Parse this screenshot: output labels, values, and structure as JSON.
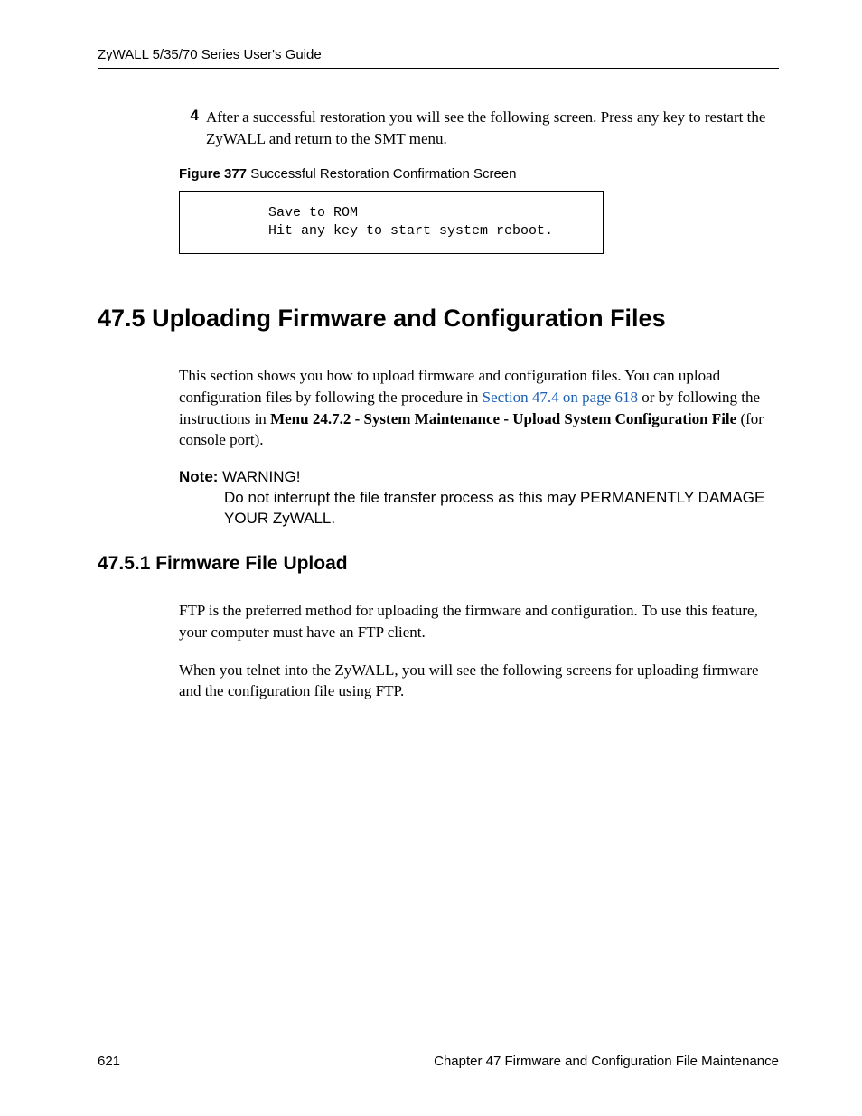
{
  "header": {
    "title": "ZyWALL 5/35/70 Series User's Guide"
  },
  "step4": {
    "num": "4",
    "text": "After a successful restoration you will see the following screen. Press any key to restart the ZyWALL and return to the SMT menu."
  },
  "figure": {
    "label": "Figure 377",
    "caption": "   Successful Restoration Confirmation Screen",
    "terminal_line1": "Save to ROM",
    "terminal_line2": "Hit any key to start system reboot."
  },
  "section": {
    "number": "47.5",
    "title": "  Uploading Firmware and Configuration Files",
    "para1_a": "This section shows you how to upload firmware and configuration files. You can upload configuration files by following the procedure in ",
    "para1_link": "Section 47.4 on page 618",
    "para1_b": " or by following the instructions in ",
    "para1_bold": "Menu 24.7.2 - System Maintenance - Upload System Configuration File",
    "para1_c": " (for console port).",
    "note_label": "Note: ",
    "note_first": "WARNING!",
    "note_rest": "Do not interrupt the file transfer process as this may PERMANENTLY DAMAGE YOUR ZyWALL."
  },
  "subsection": {
    "number": "47.5.1",
    "title": "  Firmware File Upload",
    "para1": "FTP is the preferred method for uploading the firmware and configuration. To use this feature, your computer must have an FTP client.",
    "para2": "When you telnet into the ZyWALL, you will see the following screens for uploading firmware and the configuration file using FTP."
  },
  "footer": {
    "page": "621",
    "chapter": "Chapter 47 Firmware and Configuration File Maintenance"
  }
}
